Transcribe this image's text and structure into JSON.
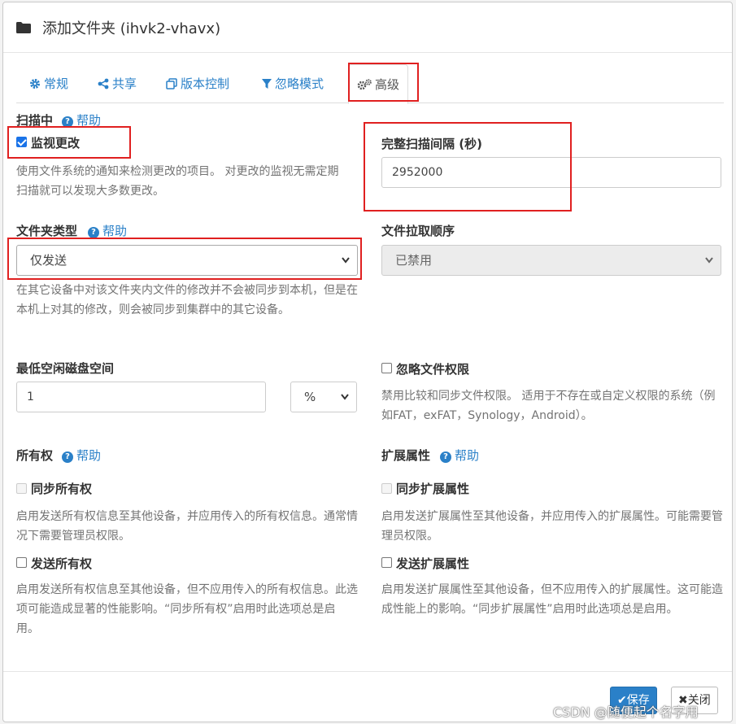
{
  "header": {
    "title": "添加文件夹 (ihvk2-vhavx)"
  },
  "tabs": [
    {
      "label": "常规",
      "icon": "gear-icon"
    },
    {
      "label": "共享",
      "icon": "share-icon"
    },
    {
      "label": "版本控制",
      "icon": "copy-icon"
    },
    {
      "label": "忽略模式",
      "icon": "filter-icon"
    },
    {
      "label": "高级",
      "icon": "gears-icon",
      "active": true
    }
  ],
  "scanning": {
    "label": "扫描中",
    "help": "帮助",
    "watch_label": "监视更改",
    "watch_checked": true,
    "watch_desc": "使用文件系统的通知来检测更改的项目。 对更改的监视无需定期扫描就可以发现大多数更改。"
  },
  "rescan": {
    "label": "完整扫描间隔 (秒)",
    "value": "2952000"
  },
  "folder_type": {
    "label": "文件夹类型",
    "help": "帮助",
    "selected": "仅发送",
    "desc": "在其它设备中对该文件夹内文件的修改并不会被同步到本机，但是在本机上对其的修改，则会被同步到集群中的其它设备。"
  },
  "pull_order": {
    "label": "文件拉取顺序",
    "selected": "已禁用"
  },
  "min_disk": {
    "label": "最低空闲磁盘空间",
    "value": "1",
    "unit": "%"
  },
  "ignore_perms": {
    "label": "忽略文件权限",
    "checked": false,
    "desc": "禁用比较和同步文件权限。 适用于不存在或自定义权限的系统（例如FAT，exFAT，Synology，Android）。"
  },
  "ownership": {
    "label": "所有权",
    "help": "帮助",
    "sync_label": "同步所有权",
    "sync_desc": "启用发送所有权信息至其他设备，并应用传入的所有权信息。通常情况下需要管理员权限。",
    "send_label": "发送所有权",
    "send_desc": "启用发送所有权信息至其他设备，但不应用传入的所有权信息。此选项可能造成显著的性能影响。“同步所有权”启用时此选项总是启用。"
  },
  "xattrs": {
    "label": "扩展属性",
    "help": "帮助",
    "sync_label": "同步扩展属性",
    "sync_desc": "启用发送扩展属性至其他设备，并应用传入的扩展属性。可能需要管理员权限。",
    "send_label": "发送扩展属性",
    "send_desc": "启用发送扩展属性至其他设备，但不应用传入的扩展属性。这可能造成性能上的影响。“同步扩展属性”启用时此选项总是启用。"
  },
  "footer": {
    "save_label": "保存",
    "close_label": "关闭"
  },
  "watermark": "CSDN @随便起个名字用",
  "colors": {
    "accent": "#2a80c8",
    "highlight_box": "#e02020"
  }
}
